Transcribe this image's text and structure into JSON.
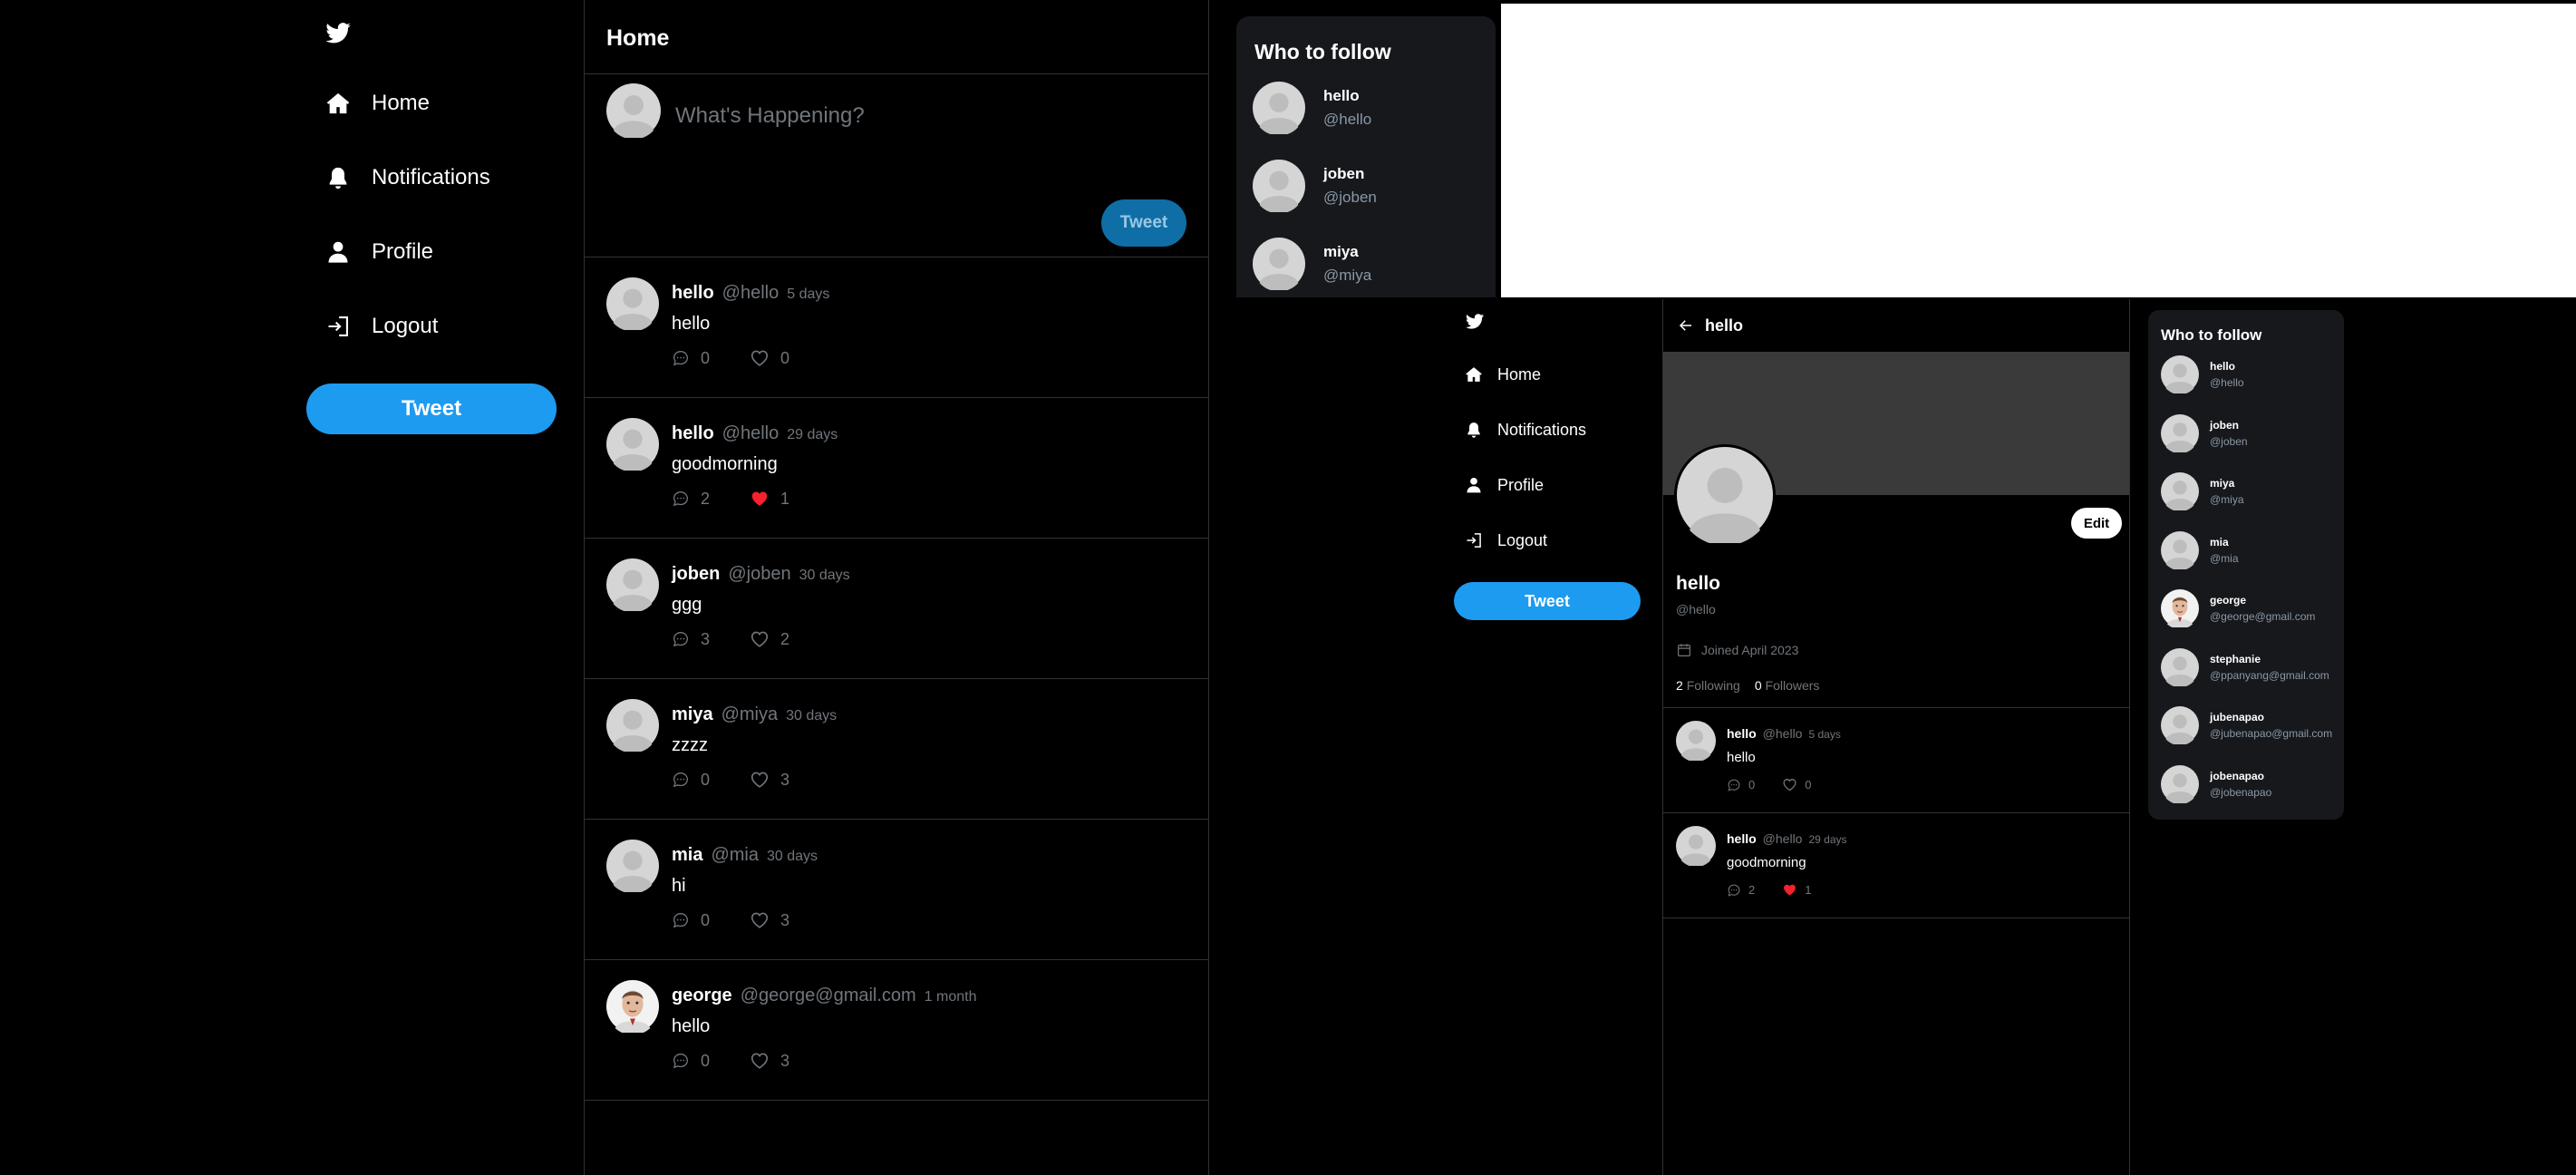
{
  "colors": {
    "accent": "#1d9bf0",
    "background": "#000000",
    "like_active": "#f91880",
    "muted": "#71767b",
    "panel": "#16181c"
  },
  "nav": {
    "items": [
      {
        "label": "Home",
        "icon": "home-icon"
      },
      {
        "label": "Notifications",
        "icon": "bell-icon"
      },
      {
        "label": "Profile",
        "icon": "user-icon"
      },
      {
        "label": "Logout",
        "icon": "logout-icon"
      }
    ],
    "tweet_label": "Tweet"
  },
  "home": {
    "title": "Home",
    "compose_placeholder": "What's Happening?",
    "compose_button": "Tweet",
    "posts": [
      {
        "name": "hello",
        "handle": "@hello",
        "time": "5 days",
        "text": "hello",
        "replies": "0",
        "likes": "0",
        "liked": false
      },
      {
        "name": "hello",
        "handle": "@hello",
        "time": "29 days",
        "text": "goodmorning",
        "replies": "2",
        "likes": "1",
        "liked": true
      },
      {
        "name": "joben",
        "handle": "@joben",
        "time": "30 days",
        "text": "ggg",
        "replies": "3",
        "likes": "2",
        "liked": false
      },
      {
        "name": "miya",
        "handle": "@miya",
        "time": "30 days",
        "text": "zzzz",
        "replies": "0",
        "likes": "3",
        "liked": false
      },
      {
        "name": "mia",
        "handle": "@mia",
        "time": "30 days",
        "text": "hi",
        "replies": "0",
        "likes": "3",
        "liked": false
      },
      {
        "name": "george",
        "handle": "@george@gmail.com",
        "time": "1 month",
        "text": "hello",
        "replies": "0",
        "likes": "3",
        "liked": false,
        "photo": true
      }
    ]
  },
  "who_to_follow_top": {
    "title": "Who to follow",
    "users": [
      {
        "name": "hello",
        "handle": "@hello"
      },
      {
        "name": "joben",
        "handle": "@joben"
      },
      {
        "name": "miya",
        "handle": "@miya"
      }
    ]
  },
  "profile": {
    "back_title": "hello",
    "name": "hello",
    "handle": "@hello",
    "edit_label": "Edit",
    "joined": "Joined April 2023",
    "following_count": "2",
    "following_label": "Following",
    "followers_count": "0",
    "followers_label": "Followers",
    "posts": [
      {
        "name": "hello",
        "handle": "@hello",
        "time": "5 days",
        "text": "hello",
        "replies": "0",
        "likes": "0",
        "liked": false
      },
      {
        "name": "hello",
        "handle": "@hello",
        "time": "29 days",
        "text": "goodmorning",
        "replies": "2",
        "likes": "1",
        "liked": true
      }
    ]
  },
  "who_to_follow_side": {
    "title": "Who to follow",
    "users": [
      {
        "name": "hello",
        "handle": "@hello"
      },
      {
        "name": "joben",
        "handle": "@joben"
      },
      {
        "name": "miya",
        "handle": "@miya"
      },
      {
        "name": "mia",
        "handle": "@mia"
      },
      {
        "name": "george",
        "handle": "@george@gmail.com",
        "photo": true
      },
      {
        "name": "stephanie",
        "handle": "@ppanyang@gmail.com"
      },
      {
        "name": "jubenapao",
        "handle": "@jubenapao@gmail.com"
      },
      {
        "name": "jobenapao",
        "handle": "@jobenapao"
      }
    ]
  }
}
